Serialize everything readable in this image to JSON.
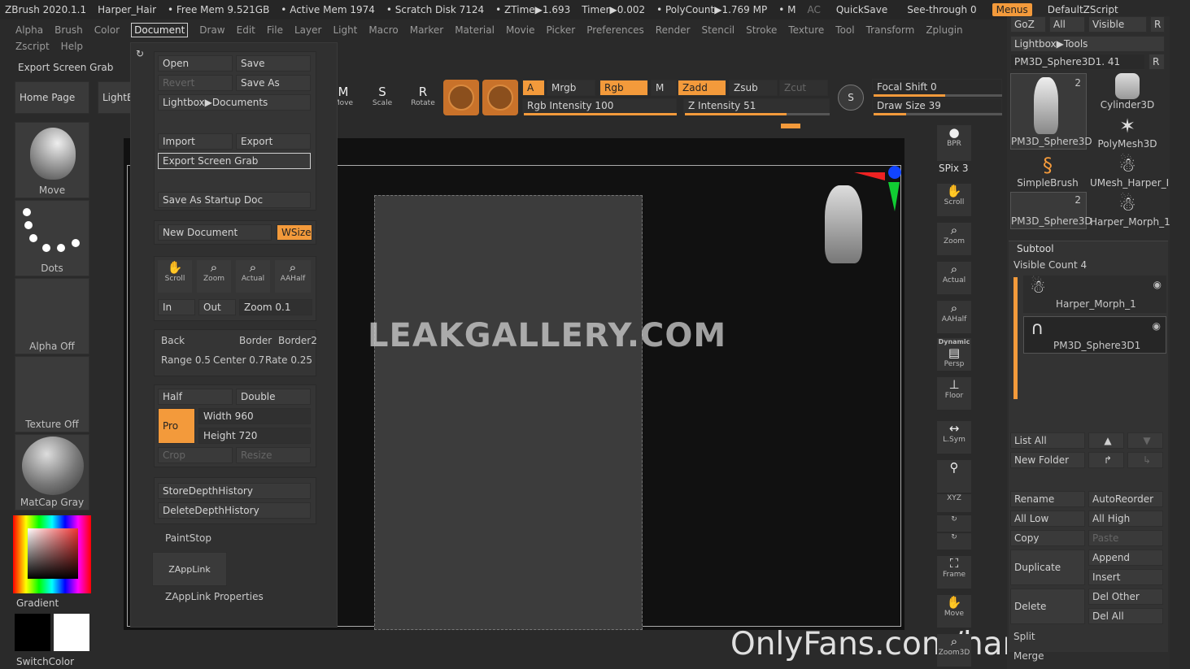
{
  "titlebar": {
    "app": "ZBrush 2020.1.1",
    "doc": "Harper_Hair",
    "freemem": "• Free Mem 9.521GB",
    "activemem": "• Active Mem 1974",
    "scratch": "• Scratch Disk 7124",
    "ztime": "• ZTime▶1.693",
    "timer": "Timer▶0.002",
    "polycount": "• PolyCount▶1.769 MP",
    "m": "• M",
    "ac": "AC",
    "quicksave": "QuickSave",
    "seethrough": "See-through",
    "seethrough_val": "0",
    "menus": "Menus",
    "script": "DefaultZScript"
  },
  "menubar": [
    "Alpha",
    "Brush",
    "Color",
    "Document",
    "Draw",
    "Edit",
    "File",
    "Layer",
    "Light",
    "Macro",
    "Marker",
    "Material",
    "Movie",
    "Picker",
    "Preferences",
    "Render",
    "Stencil",
    "Stroke",
    "Texture",
    "Tool",
    "Transform",
    "Zplugin"
  ],
  "menubar2": [
    "Zscript",
    "Help"
  ],
  "export_label": "Export Screen Grab",
  "shelf": {
    "home": "Home Page",
    "lightbox": "LightBox",
    "move": "Move",
    "scale": "Scale",
    "rotate": "Rotate",
    "a": "A",
    "mrgb": "Mrgb",
    "rgb": "Rgb",
    "m": "M",
    "zadd": "Zadd",
    "zsub": "Zsub",
    "zcut": "Zcut",
    "rgb_intensity": "Rgb Intensity 100",
    "z_intensity": "Z Intensity 51",
    "focal_shift": "Focal Shift 0",
    "draw_size": "Draw Size 39"
  },
  "left": {
    "move": "Move",
    "dots": "Dots",
    "alpha": "Alpha Off",
    "texture": "Texture Off",
    "matcap": "MatCap Gray",
    "gradient": "Gradient",
    "switch": "SwitchColor"
  },
  "docmenu": {
    "open": "Open",
    "save": "Save",
    "revert": "Revert",
    "saveas": "Save As",
    "lightbox_docs": "Lightbox▶Documents",
    "import": "Import",
    "export": "Export",
    "export_grab": "Export Screen Grab",
    "save_startup": "Save As Startup Doc",
    "new_doc": "New Document",
    "wsize": "WSize",
    "scroll": "Scroll",
    "zoom": "Zoom",
    "actual": "Actual",
    "aahalf": "AAHalf",
    "in": "In",
    "out": "Out",
    "zoom_val": "Zoom 0.1",
    "back": "Back",
    "border": "Border",
    "border2": "Border2",
    "range": "Range 0.5",
    "center": "Center 0.7",
    "rate": "Rate 0.25",
    "half": "Half",
    "double": "Double",
    "pro": "Pro",
    "width": "Width 960",
    "height": "Height 720",
    "crop": "Crop",
    "resize": "Resize",
    "store_depth": "StoreDepthHistory",
    "delete_depth": "DeleteDepthHistory",
    "paintstop": "PaintStop",
    "zapplink": "ZAppLink",
    "zapplink_props": "ZAppLink Properties"
  },
  "viewport": {
    "watermark": "LEAKGALLERY.COM",
    "credit": "OnlyFans.com/harperthefox"
  },
  "vtools": {
    "bpr": "BPR",
    "spix": "SPix 3",
    "scroll": "Scroll",
    "zoom": "Zoom",
    "actual": "Actual",
    "aahalf": "AAHalf",
    "dynamic": "Dynamic",
    "persp": "Persp",
    "floor": "Floor",
    "lsym": "L.Sym",
    "xyz": "XYZ",
    "frame": "Frame",
    "move": "Move",
    "zoom3d": "Zoom3D"
  },
  "right": {
    "goz": "GoZ",
    "all": "All",
    "visible": "Visible",
    "r": "R",
    "lightbox_tools": "Lightbox▶Tools",
    "current_tool": "PM3D_Sphere3D1. 41",
    "thumbs": [
      "PM3D_Sphere3D",
      "Cylinder3D",
      "PolyMesh3D",
      "SimpleBrush",
      "UMesh_Harper_I",
      "PM3D_Sphere3D",
      "Harper_Morph_1"
    ],
    "thumb_count_1": "2",
    "thumb_count_2": "2",
    "subtool": "Subtool",
    "visible_count": "Visible Count 4",
    "sub1": "Harper_Morph_1",
    "sub2": "PM3D_Sphere3D1",
    "listall": "List All",
    "newfolder": "New Folder",
    "rename": "Rename",
    "autoreorder": "AutoReorder",
    "alllow": "All Low",
    "allhigh": "All High",
    "copy": "Copy",
    "paste": "Paste",
    "duplicate": "Duplicate",
    "append": "Append",
    "insert": "Insert",
    "delete": "Delete",
    "delother": "Del Other",
    "delall": "Del All",
    "split": "Split",
    "merge": "Merge"
  }
}
